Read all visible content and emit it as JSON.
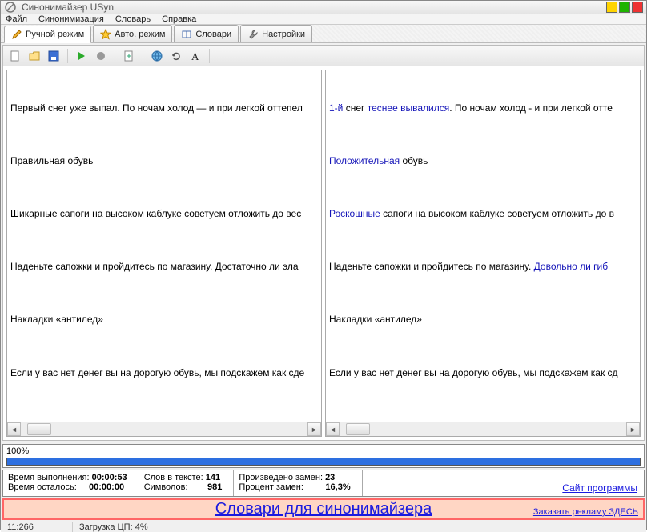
{
  "title": "Синонимайзер USyn",
  "menu": {
    "file": "Файл",
    "synon": "Синонимизация",
    "dict": "Словарь",
    "help": "Справка"
  },
  "tabs": {
    "manual": "Ручной режим",
    "auto": "Авто. режим",
    "dicts": "Словари",
    "settings": "Настройки"
  },
  "left": {
    "p1": "Первый снег уже выпал. По ночам холод — и при легкой оттепел",
    "p2": "Правильная обувь",
    "p3": "Шикарные сапоги на высоком каблуке советуем отложить до вес",
    "p4": "Наденьте сапожки и пройдитесь по магазину. Достаточно ли эла",
    "p5": "Накладки «антилед»",
    "p6": "Если у вас нет денег вы на дорогую обувь, мы подскажем как сде"
  },
  "right": {
    "p1a": "1-й",
    "p1b": " снег ",
    "p1c": "теснее вывалился",
    "p1d": ". По ночам холод - и при легкой отте",
    "p2a": "Положительная",
    "p2b": " обувь",
    "p3a": "Роскошные",
    "p3b": " сапоги на высоком каблуке советуем отложить до в",
    "p4a": "Наденьте сапожки и пройдитесь по магазину. ",
    "p4b": "Довольно ли гиб",
    "p5": "Накладки «антилед»",
    "p6": "Если у вас нет денег вы на дорогую обувь, мы подскажем как сд"
  },
  "progress": {
    "label": "100%"
  },
  "stats": {
    "time_exec_l": "Время выполнения: ",
    "time_exec_v": "00:00:53",
    "time_left_l": "Время осталось:     ",
    "time_left_v": "00:00:00",
    "words_l": "Слов в тексте: ",
    "words_v": "141",
    "chars_l": "Символов:        ",
    "chars_v": "981",
    "repl_l": "Произведено замен: ",
    "repl_v": "23",
    "pct_l": "Процент замен:         ",
    "pct_v": "16,3%",
    "sitelink": "Сайт программы"
  },
  "ad": {
    "main": "Словари для синонимайзера",
    "order": "Заказать рекламу ЗДЕСЬ"
  },
  "status": {
    "pos": "11:266",
    "cpu": "Загрузка ЦП: 4%"
  }
}
